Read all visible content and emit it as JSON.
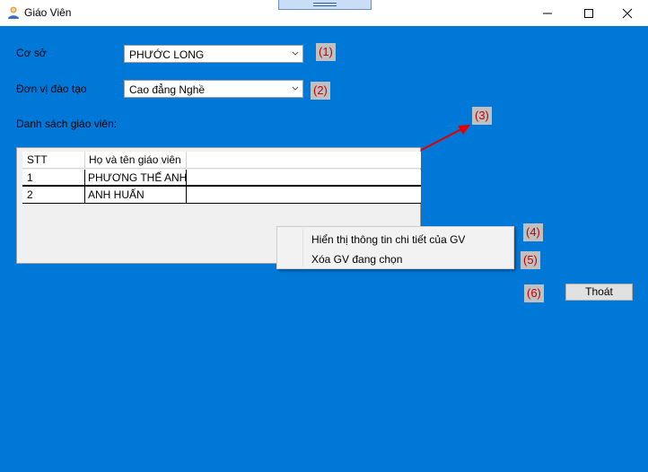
{
  "window": {
    "title": "Giáo Viên"
  },
  "form": {
    "co_so_label": "Cơ sở",
    "co_so_value": "PHƯỚC LONG",
    "don_vi_label": "Đơn vị đào tạo",
    "don_vi_value": "Cao đẳng Nghề",
    "list_label": "Danh sách giáo viên:"
  },
  "table": {
    "columns": [
      "STT",
      "Họ và tên giáo viên"
    ],
    "rows": [
      {
        "stt": "1",
        "name": "PHƯƠNG THẾ ANH"
      },
      {
        "stt": "2",
        "name": "ANH HUẤN"
      }
    ]
  },
  "context_menu": {
    "items": [
      "Hiển thị thông tin chi tiết của GV",
      "Xóa GV đang chọn"
    ]
  },
  "buttons": {
    "exit": "Thoát"
  },
  "annotations": [
    "(1)",
    "(2)",
    "(3)",
    "(4)",
    "(5)",
    "(6)"
  ],
  "colors": {
    "background": "#0078d7",
    "annotation_text": "#c00000",
    "annotation_bg": "#c0c0c0",
    "arrow": "#e00000"
  }
}
